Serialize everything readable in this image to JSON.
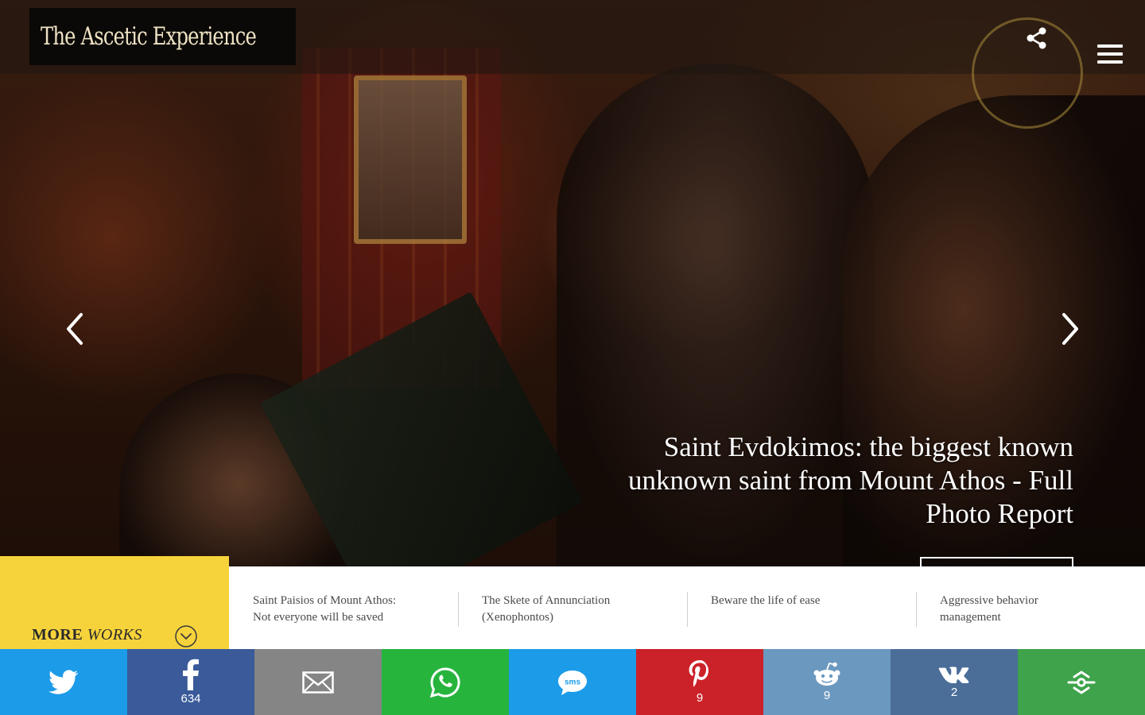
{
  "header": {
    "logo_text": "The Ascetic Experience"
  },
  "hero": {
    "headline": "Saint Evdokimos: the biggest known unknown saint from Mount Athos - Full Photo Report"
  },
  "more_works": {
    "label_bold": "MORE",
    "label_italic": "WORKS"
  },
  "related": [
    {
      "title_line1": "Saint Paisios of Mount Athos:",
      "title_line2": "Not everyone will be saved"
    },
    {
      "title_line1": "The Skete of Annunciation",
      "title_line2": "(Xenophontos)"
    },
    {
      "title_line1": "Beware the life of ease",
      "title_line2": ""
    },
    {
      "title_line1": "Aggressive behavior",
      "title_line2": "management"
    }
  ],
  "share_bar": [
    {
      "service": "twitter",
      "icon": "twitter-bird-icon",
      "color": "#1c9be8",
      "count": ""
    },
    {
      "service": "facebook",
      "icon": "facebook-icon",
      "color": "#3a5a99",
      "count": "634"
    },
    {
      "service": "email",
      "icon": "envelope-icon",
      "color": "#858585",
      "count": ""
    },
    {
      "service": "whatsapp",
      "icon": "whatsapp-icon",
      "color": "#27b43d",
      "count": ""
    },
    {
      "service": "sms",
      "icon": "sms-bubble-icon",
      "color": "#1c9be8",
      "count": ""
    },
    {
      "service": "pinterest",
      "icon": "pinterest-icon",
      "color": "#cb2128",
      "count": "9"
    },
    {
      "service": "reddit",
      "icon": "reddit-icon",
      "color": "#6b98bf",
      "count": "9"
    },
    {
      "service": "vk",
      "icon": "vk-icon",
      "color": "#4b6e99",
      "count": "2"
    },
    {
      "service": "more",
      "icon": "share-more-icon",
      "color": "#3ea34a",
      "count": ""
    }
  ],
  "colors": {
    "more_works_bg": "#f6d33b",
    "related_bg": "#ffffff",
    "logo_bg": "#0b0907",
    "logo_text": "#efe3c4"
  }
}
